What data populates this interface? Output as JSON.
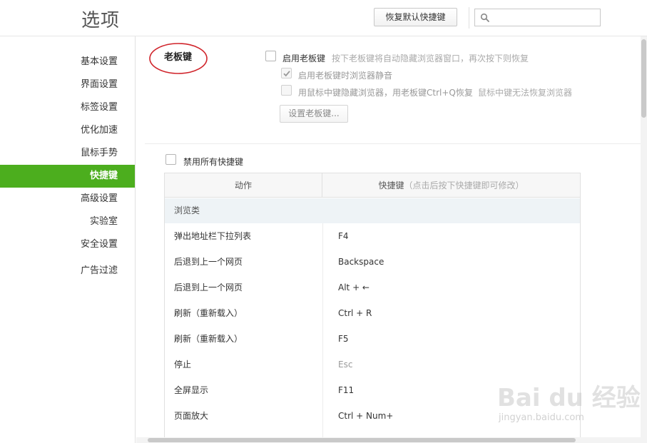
{
  "header": {
    "title": "选项",
    "restore_button": "恢复默认快捷键",
    "search": {
      "value": "",
      "placeholder": ""
    }
  },
  "sidebar": {
    "items": [
      {
        "label": "基本设置",
        "active": false
      },
      {
        "label": "界面设置",
        "active": false
      },
      {
        "label": "标签设置",
        "active": false
      },
      {
        "label": "优化加速",
        "active": false
      },
      {
        "label": "鼠标手势",
        "active": false
      },
      {
        "label": "快捷键",
        "active": true
      },
      {
        "label": "高级设置",
        "active": false
      },
      {
        "label": "实验室",
        "active": false
      },
      {
        "label": "安全设置",
        "active": false
      },
      {
        "label": "广告过滤",
        "active": false
      }
    ]
  },
  "boss_key": {
    "section_title": "老板键",
    "enable_label": "启用老板键",
    "enable_checked": false,
    "enable_hint": "按下老板键将自动隐藏浏览器窗口，再次按下则恢复",
    "mute_label": "启用老板键时浏览器静音",
    "mute_checked": true,
    "middle_click_label": "用鼠标中键隐藏浏览器，用老板键Ctrl+Q恢复",
    "middle_click_checked": false,
    "middle_click_hint": "鼠标中键无法恢复浏览器",
    "set_button": "设置老板键..."
  },
  "shortcuts": {
    "disable_all_label": "禁用所有快捷键",
    "disable_all_checked": false,
    "col_action": "动作",
    "col_key": "快捷键",
    "col_key_hint": "（点击后按下快捷键即可修改）",
    "category": "浏览类",
    "rows": [
      {
        "action": "弹出地址栏下拉列表",
        "key": "F4"
      },
      {
        "action": "后退到上一个网页",
        "key": "Backspace"
      },
      {
        "action": "后退到上一个网页",
        "key": "Alt + ←"
      },
      {
        "action": "刷新（重新载入）",
        "key": "Ctrl + R"
      },
      {
        "action": "刷新（重新载入）",
        "key": "F5"
      },
      {
        "action": "停止",
        "key": "Esc"
      },
      {
        "action": "全屏显示",
        "key": "F11"
      },
      {
        "action": "页面放大",
        "key": "Ctrl + Num+"
      }
    ]
  },
  "watermark": {
    "logo": "Bai du 经验",
    "url": "jingyan.baidu.com"
  },
  "colors": {
    "accent": "#4cae1e",
    "annotation": "#d0232a"
  }
}
